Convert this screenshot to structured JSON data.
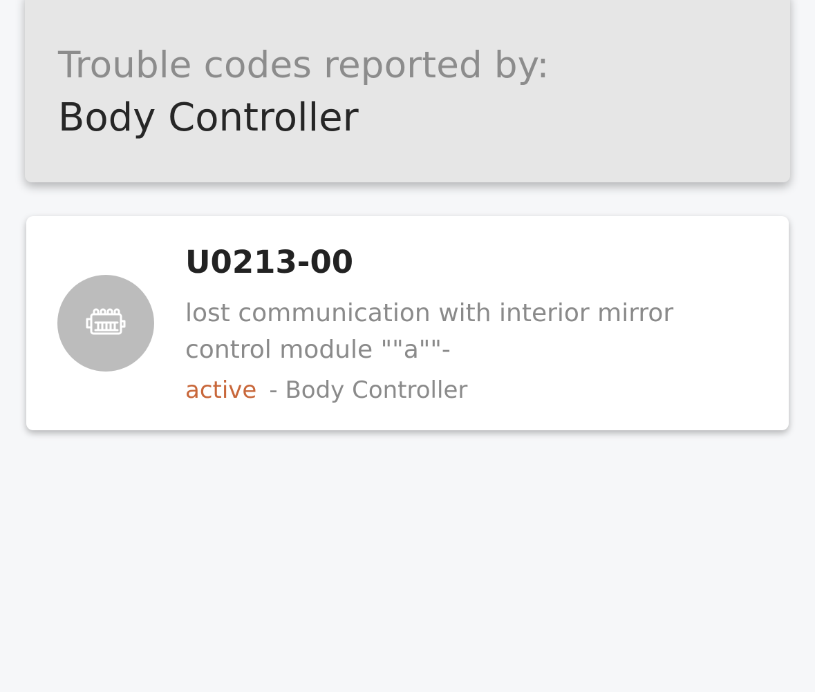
{
  "header": {
    "label": "Trouble codes reported by:",
    "module_name": "Body Controller"
  },
  "trouble_codes": [
    {
      "code": "U0213-00",
      "description": "lost communication with interior mirror control module \"\"a\"\"-",
      "status": "active",
      "separator": "-",
      "module": "Body Controller",
      "icon": "engine-icon"
    }
  ],
  "colors": {
    "background": "#f6f7f9",
    "header_background": "#e6e6e6",
    "icon_circle": "#bcbcbc",
    "status_active": "#c8673a"
  }
}
